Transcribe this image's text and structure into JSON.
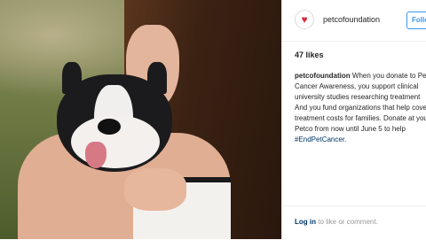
{
  "post": {
    "username": "petcofoundation",
    "follow_label": "Follow",
    "likes": "47 likes",
    "caption": {
      "user": "petcofoundation",
      "lines": [
        "When you donate to Petco for",
        "Cancer Awareness, you support clinical",
        "university studies researching treatment",
        "And you fund organizations that help cover",
        "treatment costs for families. Donate at your",
        "Petco from now until June 5 to help"
      ],
      "hashtag": "#EndPetCancer."
    },
    "footer": {
      "login": "Log in",
      "rest": "to like or comment."
    }
  },
  "icons": {
    "avatar": "heart-logo-icon"
  },
  "colors": {
    "link": "#003569",
    "follow": "#3897f0",
    "logo_heart": "#d52b3c"
  }
}
